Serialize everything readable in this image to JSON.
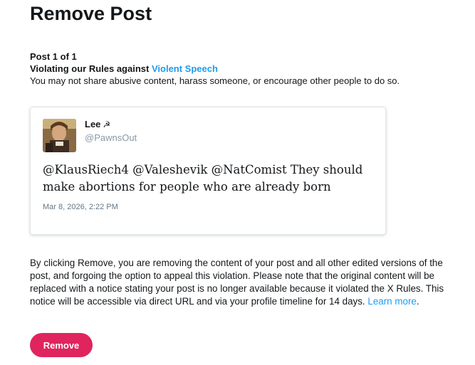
{
  "page": {
    "title": "Remove Post"
  },
  "violation": {
    "post_count": "Post 1 of 1",
    "rule_prefix": "Violating our Rules against",
    "rule_link": "Violent Speech",
    "rule_description": "You may not share abusive content, harass someone, or encourage other people to do so."
  },
  "tweet": {
    "author_name": "Lee",
    "author_badge": "☭",
    "handle": "@PawnsOut",
    "text": "@KlausRiech4 @Valeshevik @NatComist They should make abortions for people who are already born",
    "timestamp": "Mar 8, 2026, 2:22 PM"
  },
  "disclaimer": {
    "text": "By clicking Remove, you are removing the content of your post and all other edited versions of the post, and forgoing the option to appeal this violation. Please note that the original content will be replaced with a notice stating your post is no longer available because it violated the X Rules. This notice will be accessible via direct URL and via your profile timeline for 14 days.",
    "learn_more": "Learn more",
    "learn_more_suffix": "."
  },
  "actions": {
    "remove_label": "Remove"
  },
  "colors": {
    "accent": "#1d9bf0",
    "danger": "#e0245e",
    "muted": "#8899a6"
  }
}
